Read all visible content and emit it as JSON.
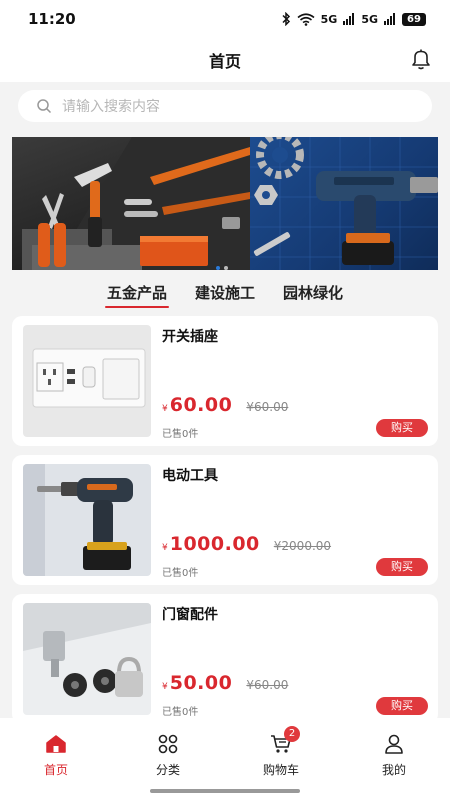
{
  "status_bar": {
    "time": "11:20",
    "network_5g_1": "5G",
    "network_5g_2": "5G",
    "battery": "69"
  },
  "header": {
    "title": "首页",
    "bell_icon": "bell-icon"
  },
  "search": {
    "placeholder": "请输入搜索内容",
    "icon": "search-icon"
  },
  "banner": {
    "slide_count": 2,
    "active_index": 0
  },
  "tabs": [
    {
      "label": "五金产品",
      "active": true
    },
    {
      "label": "建设施工",
      "active": false
    },
    {
      "label": "园林绿化",
      "active": false
    }
  ],
  "products": [
    {
      "name": "开关插座",
      "currency": "¥",
      "price": "60.00",
      "original_price": "¥60.00",
      "sold": "已售0件",
      "buy_label": "购买"
    },
    {
      "name": "电动工具",
      "currency": "¥",
      "price": "1000.00",
      "original_price": "¥2000.00",
      "sold": "已售0件",
      "buy_label": "购买"
    },
    {
      "name": "门窗配件",
      "currency": "¥",
      "price": "50.00",
      "original_price": "¥60.00",
      "sold": "已售0件",
      "buy_label": "购买"
    }
  ],
  "bottom_nav": [
    {
      "label": "首页",
      "icon": "home-icon",
      "active": true
    },
    {
      "label": "分类",
      "icon": "grid-icon",
      "active": false
    },
    {
      "label": "购物车",
      "icon": "cart-icon",
      "active": false,
      "badge": "2"
    },
    {
      "label": "我的",
      "icon": "user-icon",
      "active": false
    }
  ],
  "colors": {
    "accent": "#d9272e",
    "background": "#f3f3f3",
    "card": "#ffffff"
  }
}
